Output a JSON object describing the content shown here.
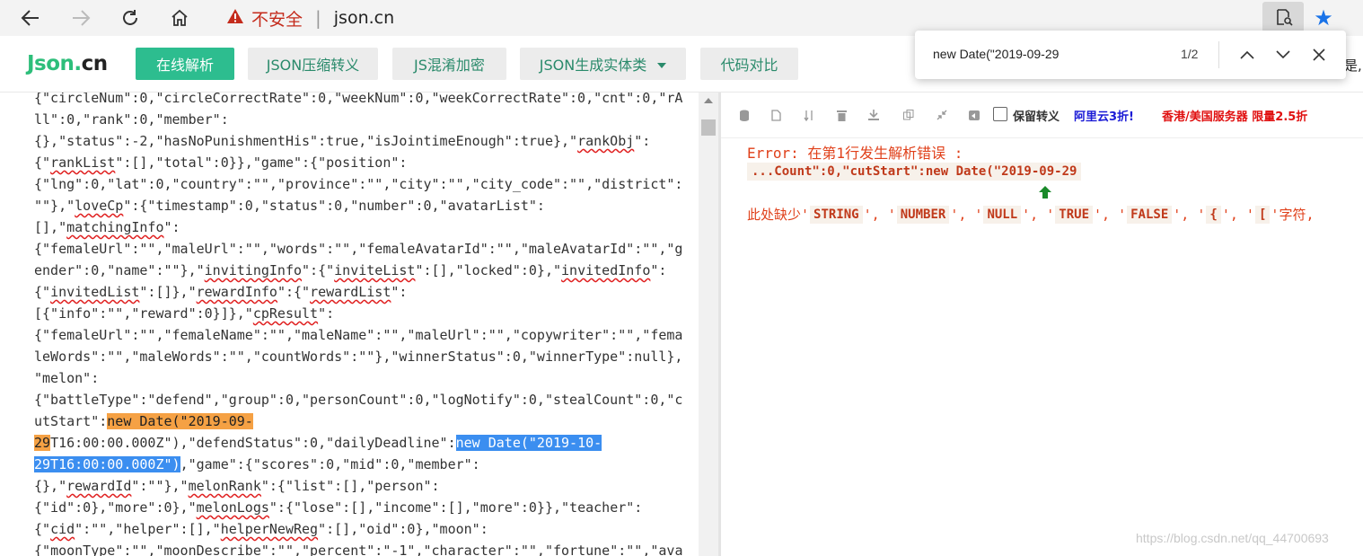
{
  "browser": {
    "security_text": "不安全",
    "url": "json.cn",
    "icons": {
      "back": "back-arrow-icon",
      "forward": "forward-arrow-icon",
      "refresh": "refresh-icon",
      "home": "home-icon",
      "warning": "warning-triangle-icon",
      "reader": "reader-view-icon",
      "favorite": "star-icon"
    }
  },
  "site": {
    "logo_part1": "Json.",
    "logo_part2": "cn",
    "nav": [
      {
        "label": "在线解析",
        "active": true
      },
      {
        "label": "JSON压缩转义",
        "active": false
      },
      {
        "label": "JS混淆加密",
        "active": false
      },
      {
        "label": "JSON生成实体类",
        "active": false,
        "dropdown": true
      },
      {
        "label": "代码对比",
        "active": false
      }
    ],
    "header_tail": "是,"
  },
  "find": {
    "query": "new Date(\"2019-09-29",
    "count": "1/2"
  },
  "toolbar": {
    "keep_escape_label": "保留转义",
    "ad1": "阿里云3折!",
    "ad2": "香港/美国服务器 限量2.5折"
  },
  "error": {
    "title": "Error: 在第1行发生解析错误 :",
    "snippet": "...Count\":0,\"cutStart\":new Date(\"2019-09-29",
    "missing_prefix": "此处缺少'",
    "tokens": [
      "STRING",
      "NUMBER",
      "NULL",
      "TRUE",
      "FALSE",
      "{",
      "["
    ],
    "missing_suffix": "字符,"
  },
  "colors": {
    "brand": "#2dbd8f",
    "error": "#e0401a",
    "highlight_current": "#f5a144",
    "highlight_other": "#3b8ef0"
  },
  "watermark": "https://blog.csdn.net/qq_44700693",
  "editor_lines": [
    [
      {
        "t": "{\"circleNum\":0,\"circleCorrectRate\":0,\"weekNum\":0,\"weekCorrectRate\":0,\"cnt\":0,\"rA"
      }
    ],
    [
      {
        "t": "ll\":0,\"rank\":0,\"member\":"
      }
    ],
    [
      {
        "t": "{},\"status\":-2,\"hasNoPunishmentHis\":true,\"isJointimeEnough\":true},\""
      },
      {
        "t": "rankObj",
        "c": "sq"
      },
      {
        "t": "\":"
      }
    ],
    [
      {
        "t": "{\""
      },
      {
        "t": "rankList",
        "c": "sq"
      },
      {
        "t": "\":[],\"total\":0}},\"game\":{\"position\":"
      }
    ],
    [
      {
        "t": "{\"lng\":0,\"lat\":0,\"country\":\"\",\"province\":\"\",\"city\":\"\",\"city_code\":\"\",\"district\":"
      }
    ],
    [
      {
        "t": "\"\"},\""
      },
      {
        "t": "loveCp",
        "c": "sq"
      },
      {
        "t": "\":{\"timestamp\":0,\"status\":0,\"number\":0,\"avatarList\":"
      }
    ],
    [
      {
        "t": "[],\""
      },
      {
        "t": "matchingInfo",
        "c": "sq"
      },
      {
        "t": "\":"
      }
    ],
    [
      {
        "t": "{\"femaleUrl\":\"\",\"maleUrl\":\"\",\"words\":\"\",\"femaleAvatarId\":\"\",\"maleAvatarId\":\"\",\"g"
      }
    ],
    [
      {
        "t": "ender\":0,\"name\":\"\"},\""
      },
      {
        "t": "invitingInfo",
        "c": "sq"
      },
      {
        "t": "\":{\""
      },
      {
        "t": "inviteList",
        "c": "sq"
      },
      {
        "t": "\":[],\"locked\":0},\""
      },
      {
        "t": "invitedInfo",
        "c": "sq"
      },
      {
        "t": "\":"
      }
    ],
    [
      {
        "t": "{\""
      },
      {
        "t": "invitedList",
        "c": "sq"
      },
      {
        "t": "\":[]},\""
      },
      {
        "t": "rewardInfo",
        "c": "sq"
      },
      {
        "t": "\":{\""
      },
      {
        "t": "rewardList",
        "c": "sq"
      },
      {
        "t": "\":"
      }
    ],
    [
      {
        "t": "[{\"info\":\"\",\"reward\":0}]},\""
      },
      {
        "t": "cpResult",
        "c": "sq"
      },
      {
        "t": "\":"
      }
    ],
    [
      {
        "t": "{\"femaleUrl\":\"\",\"femaleName\":\"\",\"maleName\":\"\",\"maleUrl\":\"\",\"copywriter\":\"\",\"fema"
      }
    ],
    [
      {
        "t": "leWords\":\"\",\"maleWords\":\"\",\"countWords\":\"\"},\"winnerStatus\":0,\"winnerType\":null},"
      }
    ],
    [
      {
        "t": "\"melon\":"
      }
    ],
    [
      {
        "t": "{\"battleType\":\"defend\",\"group\":0,\"personCount\":0,\"logNotify\":0,\"stealCount\":0,\"c"
      }
    ],
    [
      {
        "t": "utStart\":"
      },
      {
        "t": "new Date(\"2019-09-",
        "c": "hl-orange"
      }
    ],
    [
      {
        "t": "29",
        "c": "hl-orange"
      },
      {
        "t": "T16:00:00.000Z\"),\"defendStatus\":0,\"dailyDeadline\":"
      },
      {
        "t": "new Date(\"2019-10-",
        "c": "hl-blue"
      }
    ],
    [
      {
        "t": "29T16:00:00.000Z\")",
        "c": "hl-blue"
      },
      {
        "t": ",\"game\":{\"scores\":0,\"mid\":0,\"member\":"
      }
    ],
    [
      {
        "t": "{},\""
      },
      {
        "t": "rewardId",
        "c": "sq"
      },
      {
        "t": "\":\"\"},\""
      },
      {
        "t": "melonRank",
        "c": "sq"
      },
      {
        "t": "\":{\"list\":[],\"person\":"
      }
    ],
    [
      {
        "t": "{\"id\":0},\"more\":0},\""
      },
      {
        "t": "melonLogs",
        "c": "sq"
      },
      {
        "t": "\":{\"lose\":[],\"income\":[],\"more\":0}},\"teacher\":"
      }
    ],
    [
      {
        "t": "{\""
      },
      {
        "t": "cid",
        "c": "sq"
      },
      {
        "t": "\":\"\",\"helper\":[],\""
      },
      {
        "t": "helperNewReg",
        "c": "sq"
      },
      {
        "t": "\":[],\"oid\":0},\"moon\":"
      }
    ],
    [
      {
        "t": "{\""
      },
      {
        "t": "moonType",
        "c": "sq"
      },
      {
        "t": "\":\"\",\""
      },
      {
        "t": "moonDescribe",
        "c": "sq"
      },
      {
        "t": "\":\"\",\"percent\":\"-1\",\"character\":\"\",\"fortune\":\"\",\"ava"
      }
    ]
  ]
}
